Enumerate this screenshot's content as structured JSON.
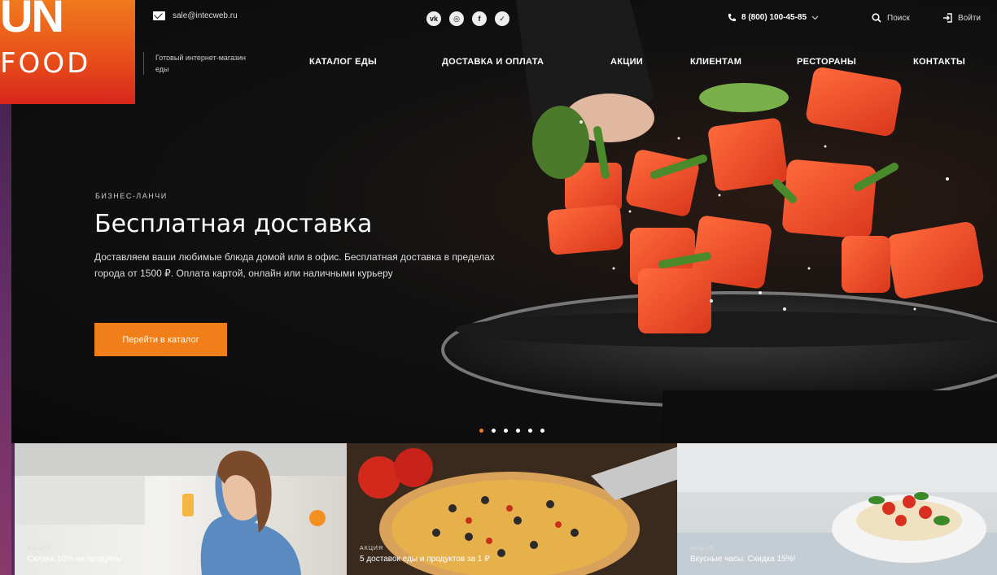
{
  "header": {
    "email": "sale@intecweb.ru",
    "socials": [
      {
        "icon": "vk-icon",
        "glyph": "vk"
      },
      {
        "icon": "instagram-icon",
        "glyph": "◎"
      },
      {
        "icon": "facebook-icon",
        "glyph": "f"
      },
      {
        "icon": "twitter-icon",
        "glyph": "✓"
      }
    ],
    "phone": "8 (800) 100-45-85",
    "search_label": "Поиск",
    "login_label": "Войти"
  },
  "logo": {
    "mark": "UN",
    "text": "FOOD"
  },
  "tagline": "Готовый интернет-магазин еды",
  "nav": [
    {
      "label": "КАТАЛОГ ЕДЫ"
    },
    {
      "label": "ДОСТАВКА И ОПЛАТА"
    },
    {
      "label": "АКЦИИ"
    },
    {
      "label": "КЛИЕНТАМ"
    },
    {
      "label": "РЕСТОРАНЫ"
    },
    {
      "label": "КОНТАКТЫ"
    }
  ],
  "hero": {
    "eyebrow": "БИЗНЕС-ЛАНЧИ",
    "title": "Бесплатная доставка",
    "description": "Доставляем ваши любимые блюда домой или в офис. Бесплатная доставка в пределах города от 1500 ₽. Оплата картой, онлайн или наличными курьеру",
    "cta": "Перейти в каталог",
    "slides_total": 6,
    "slide_active": 1
  },
  "tiles": [
    {
      "tag": "АКЦИЯ",
      "title": "Скидка 10% на продукты"
    },
    {
      "tag": "АКЦИЯ",
      "title": "5 доставок еды и продуктов за 1 ₽"
    },
    {
      "tag": "АКЦИЯ",
      "title": "Вкусные часы. Скидка 15%!"
    }
  ],
  "colors": {
    "accent": "#f07f1a",
    "logo_gradient_top": "#f07a1e",
    "logo_gradient_bottom": "#d8261c",
    "frame": "#5a2a5e"
  }
}
